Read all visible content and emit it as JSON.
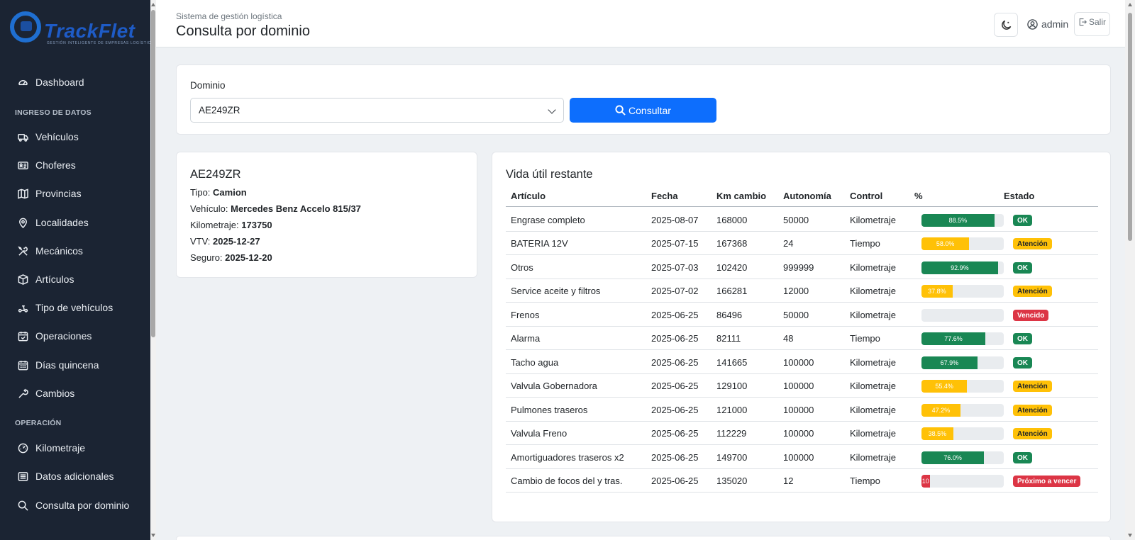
{
  "brand": {
    "name": "TrackFlet",
    "tagline": "GESTIÓN INTELIGENTE DE EMPRESAS LOGÍSTICAS"
  },
  "sidebar": {
    "items": [
      {
        "label": "Dashboard",
        "icon": "gauge-icon"
      },
      {
        "section": "INGRESO DE DATOS"
      },
      {
        "label": "Vehículos",
        "icon": "truck-icon"
      },
      {
        "label": "Choferes",
        "icon": "id-card-icon"
      },
      {
        "label": "Provincias",
        "icon": "map-icon"
      },
      {
        "label": "Localidades",
        "icon": "map-pin-icon"
      },
      {
        "label": "Mecánicos",
        "icon": "tools-icon"
      },
      {
        "label": "Artículos",
        "icon": "box-icon"
      },
      {
        "label": "Tipo de vehículos",
        "icon": "scooter-icon"
      },
      {
        "label": "Operaciones",
        "icon": "calendar-check-icon"
      },
      {
        "label": "Días quincena",
        "icon": "calendar-grid-icon"
      },
      {
        "label": "Cambios",
        "icon": "wrench-icon"
      },
      {
        "section": "OPERACIÓN"
      },
      {
        "label": "Kilometraje",
        "icon": "speedometer-icon"
      },
      {
        "label": "Datos adicionales",
        "icon": "list-icon"
      },
      {
        "label": "Consulta por dominio",
        "icon": "search-icon"
      }
    ]
  },
  "header": {
    "subtitle": "Sistema de gestión logística",
    "title": "Consulta por dominio",
    "user": "admin",
    "logout": "Salir"
  },
  "search": {
    "label": "Dominio",
    "selected": "AE249ZR",
    "button": "Consultar"
  },
  "vehicle": {
    "plate": "AE249ZR",
    "tipo_label": "Tipo:",
    "tipo": "Camion",
    "vehiculo_label": "Vehículo:",
    "vehiculo": "Mercedes Benz Accelo 815/37",
    "km_label": "Kilometraje:",
    "km": "173750",
    "vtv_label": "VTV:",
    "vtv": "2025-12-27",
    "seguro_label": "Seguro:",
    "seguro": "2025-12-20"
  },
  "table": {
    "title": "Vida útil restante",
    "columns": [
      "Artículo",
      "Fecha",
      "Km cambio",
      "Autonomía",
      "Control",
      "%",
      "Estado"
    ],
    "rows": [
      {
        "articulo": "Engrase completo",
        "fecha": "2025-08-07",
        "km": "168000",
        "autonomia": "50000",
        "control": "Kilometraje",
        "pct": 88.5,
        "pct_label": "88.5%",
        "estado": "OK",
        "status": "ok"
      },
      {
        "articulo": "BATERIA 12V",
        "fecha": "2025-07-15",
        "km": "167368",
        "autonomia": "24",
        "control": "Tiempo",
        "pct": 58.0,
        "pct_label": "58.0%",
        "estado": "Atención",
        "status": "warn"
      },
      {
        "articulo": "Otros",
        "fecha": "2025-07-03",
        "km": "102420",
        "autonomia": "999999",
        "control": "Kilometraje",
        "pct": 92.9,
        "pct_label": "92.9%",
        "estado": "OK",
        "status": "ok"
      },
      {
        "articulo": "Service aceite y filtros",
        "fecha": "2025-07-02",
        "km": "166281",
        "autonomia": "12000",
        "control": "Kilometraje",
        "pct": 37.8,
        "pct_label": "37.8%",
        "estado": "Atención",
        "status": "warn"
      },
      {
        "articulo": "Frenos",
        "fecha": "2025-06-25",
        "km": "86496",
        "autonomia": "50000",
        "control": "Kilometraje",
        "pct": 0,
        "pct_label": "",
        "estado": "Vencido",
        "status": "danger"
      },
      {
        "articulo": "Alarma",
        "fecha": "2025-06-25",
        "km": "82111",
        "autonomia": "48",
        "control": "Tiempo",
        "pct": 77.6,
        "pct_label": "77.6%",
        "estado": "OK",
        "status": "ok"
      },
      {
        "articulo": "Tacho agua",
        "fecha": "2025-06-25",
        "km": "141665",
        "autonomia": "100000",
        "control": "Kilometraje",
        "pct": 67.9,
        "pct_label": "67.9%",
        "estado": "OK",
        "status": "ok"
      },
      {
        "articulo": "Valvula Gobernadora",
        "fecha": "2025-06-25",
        "km": "129100",
        "autonomia": "100000",
        "control": "Kilometraje",
        "pct": 55.4,
        "pct_label": "55.4%",
        "estado": "Atención",
        "status": "warn"
      },
      {
        "articulo": "Pulmones traseros",
        "fecha": "2025-06-25",
        "km": "121000",
        "autonomia": "100000",
        "control": "Kilometraje",
        "pct": 47.2,
        "pct_label": "47.2%",
        "estado": "Atención",
        "status": "warn"
      },
      {
        "articulo": "Valvula Freno",
        "fecha": "2025-06-25",
        "km": "112229",
        "autonomia": "100000",
        "control": "Kilometraje",
        "pct": 38.5,
        "pct_label": "38.5%",
        "estado": "Atención",
        "status": "warn"
      },
      {
        "articulo": "Amortiguadores traseros x2",
        "fecha": "2025-06-25",
        "km": "149700",
        "autonomia": "100000",
        "control": "Kilometraje",
        "pct": 76.0,
        "pct_label": "76.0%",
        "estado": "OK",
        "status": "ok"
      },
      {
        "articulo": "Cambio de focos del y tras.",
        "fecha": "2025-06-25",
        "km": "135020",
        "autonomia": "12",
        "control": "Tiempo",
        "pct": 10,
        "pct_label": "10",
        "estado": "Próximo a vencer",
        "status": "danger"
      }
    ]
  },
  "colors": {
    "ok": "#198754",
    "warn": "#ffc107",
    "danger": "#dc3545",
    "primary": "#0d6efd",
    "sidebar": "#1b2433"
  }
}
